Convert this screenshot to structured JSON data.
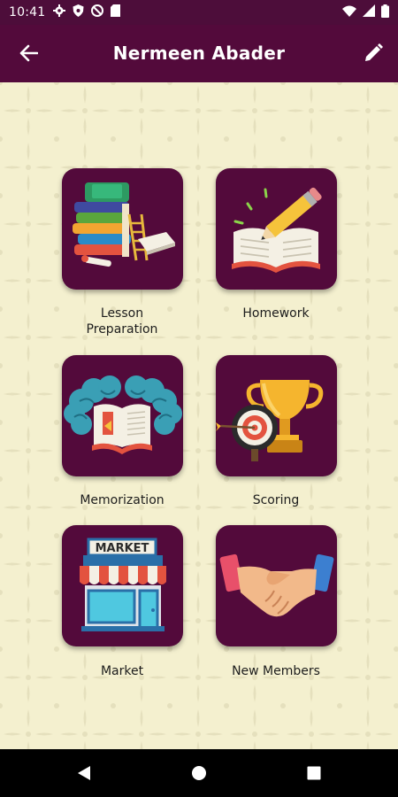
{
  "status_bar": {
    "time": "10:41",
    "left_icons": [
      "gear-icon",
      "shield-icon",
      "no-sim-icon",
      "sd-card-icon"
    ],
    "right_icons": [
      "wifi-icon",
      "signal-icon",
      "battery-icon"
    ]
  },
  "app_bar": {
    "title": "Nermeen Abader",
    "back_icon": "arrow-left-icon",
    "edit_icon": "pencil-icon"
  },
  "menu": {
    "items": [
      {
        "label": "Lesson\nPreparation",
        "icon": "books-icon"
      },
      {
        "label": "Homework",
        "icon": "notebook-pencil-icon"
      },
      {
        "label": "Memorization",
        "icon": "brain-book-icon"
      },
      {
        "label": "Scoring",
        "icon": "trophy-target-icon"
      },
      {
        "label": "Market",
        "icon": "market-store-icon",
        "sign_text": "MARKET"
      },
      {
        "label": "New Members",
        "icon": "handshake-icon"
      }
    ]
  },
  "nav_bar": {
    "buttons": [
      "back-triangle-icon",
      "home-circle-icon",
      "recents-square-icon"
    ]
  },
  "colors": {
    "primary": "#530a3b",
    "status_bar": "#4d0d3a",
    "background": "#f4f0cf",
    "pattern": "#e5e0bd"
  }
}
